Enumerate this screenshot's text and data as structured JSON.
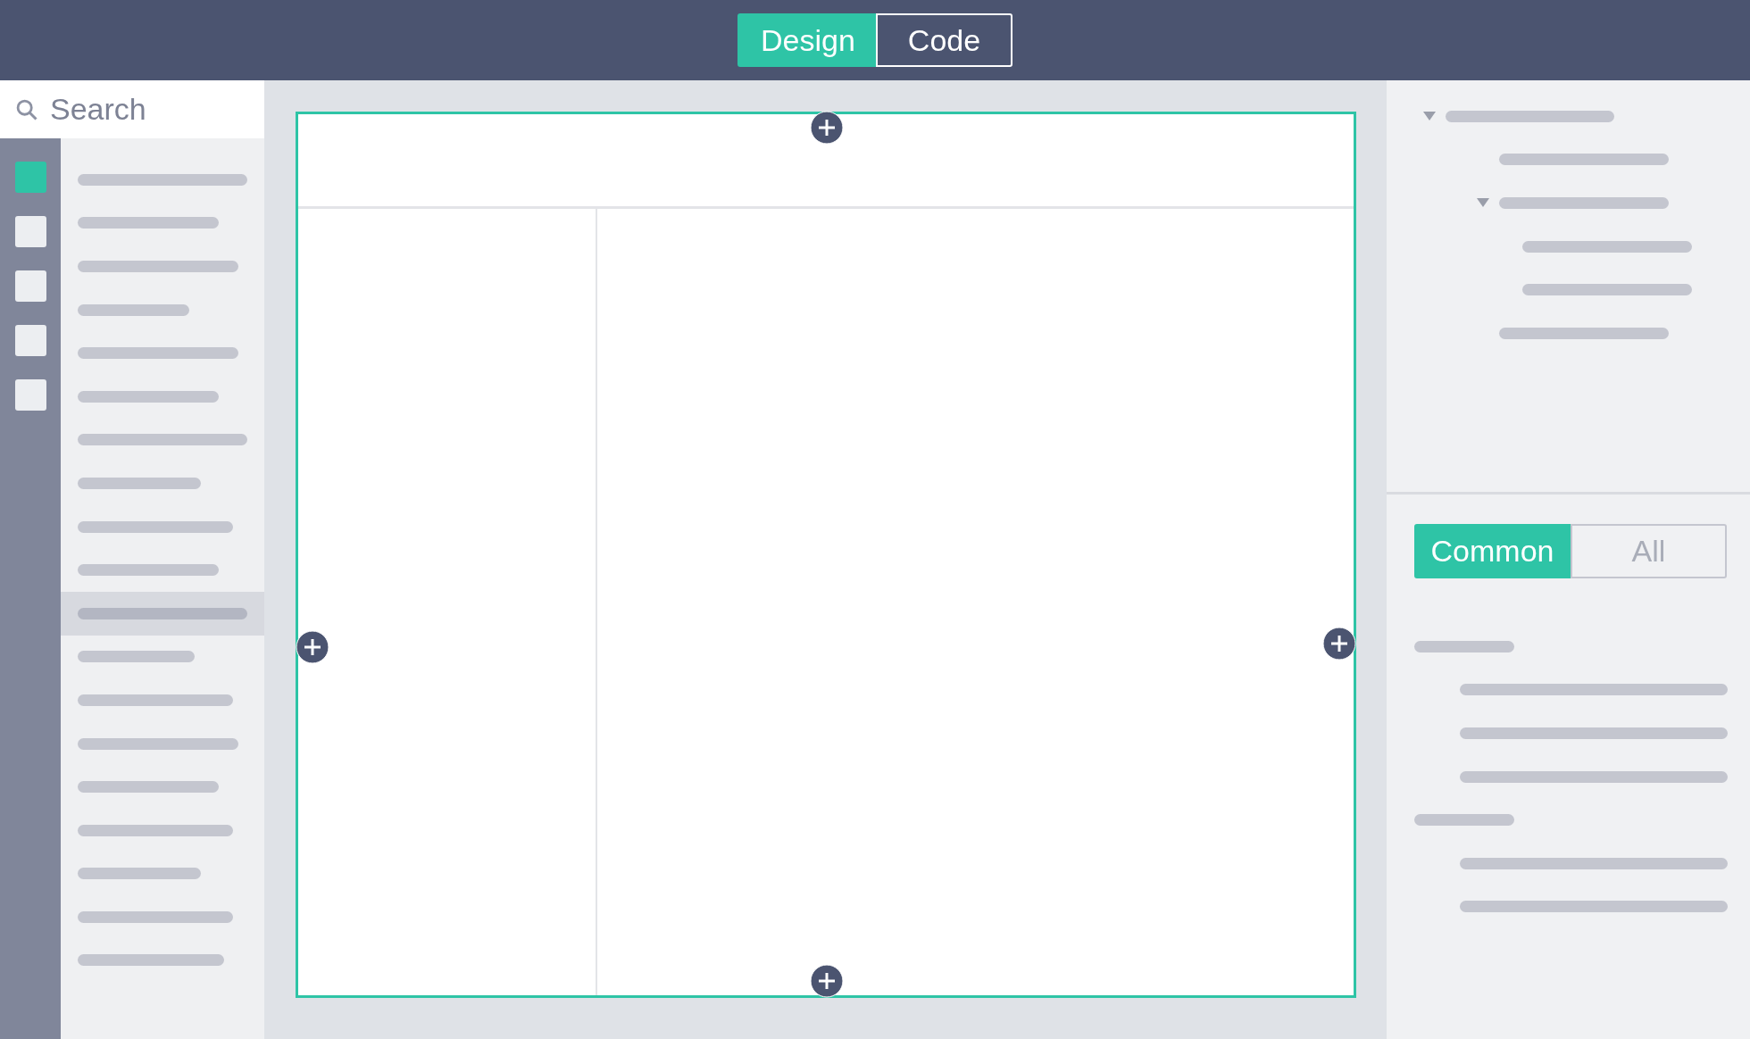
{
  "mode_switch": [
    {
      "label": "Design",
      "selected": true
    },
    {
      "label": "Code",
      "selected": false
    }
  ],
  "sidebar": {
    "search": {
      "placeholder": "Search"
    },
    "categories": [
      {
        "selected": true
      },
      {
        "selected": false
      },
      {
        "selected": false
      },
      {
        "selected": false
      },
      {
        "selected": false
      }
    ],
    "items": [
      {
        "selected": false
      },
      {
        "selected": false
      },
      {
        "selected": false
      },
      {
        "selected": false
      },
      {
        "selected": false
      },
      {
        "selected": false
      },
      {
        "selected": false
      },
      {
        "selected": false
      },
      {
        "selected": false
      },
      {
        "selected": false
      },
      {
        "selected": true
      },
      {
        "selected": false
      },
      {
        "selected": false
      },
      {
        "selected": false
      },
      {
        "selected": false
      },
      {
        "selected": false
      },
      {
        "selected": false
      },
      {
        "selected": false
      },
      {
        "selected": false
      }
    ]
  },
  "outline": [
    {
      "expanded": true,
      "children": [
        {
          "kind": "bar"
        },
        {
          "expanded": true,
          "children": [
            {
              "kind": "bar"
            },
            {
              "kind": "bar"
            }
          ]
        },
        {
          "kind": "bar"
        }
      ]
    }
  ],
  "properties": {
    "tabs": [
      {
        "label": "Common",
        "selected": true
      },
      {
        "label": "All",
        "selected": false
      }
    ],
    "groups": [
      {
        "children": [
          {
            "kind": "bar"
          },
          {
            "kind": "bar"
          },
          {
            "kind": "bar"
          }
        ]
      },
      {
        "children": [
          {
            "kind": "bar"
          },
          {
            "kind": "bar"
          }
        ]
      }
    ]
  }
}
